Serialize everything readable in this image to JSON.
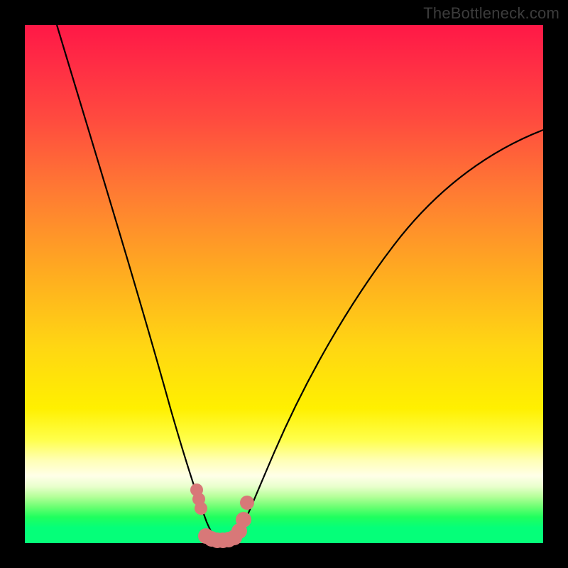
{
  "watermark_text": "TheBottleneck.com",
  "chart_data": {
    "type": "line",
    "title": "",
    "xlabel": "",
    "ylabel": "",
    "xlim": [
      0,
      100
    ],
    "ylim": [
      0,
      100
    ],
    "grid": false,
    "legend": false,
    "background_gradient": {
      "direction": "vertical",
      "stops": [
        {
          "pos": 0,
          "color": "#ff1846"
        },
        {
          "pos": 48,
          "color": "#ffac20"
        },
        {
          "pos": 74,
          "color": "#fff000"
        },
        {
          "pos": 89,
          "color": "#eaffce"
        },
        {
          "pos": 100,
          "color": "#05ff79"
        }
      ]
    },
    "series": [
      {
        "name": "left-branch",
        "x": [
          6,
          10,
          14,
          18,
          22,
          26,
          29,
          31,
          33,
          34.5,
          36
        ],
        "y": [
          100,
          83,
          67,
          52,
          38,
          25,
          15,
          9,
          4,
          1.5,
          0
        ]
      },
      {
        "name": "right-branch",
        "x": [
          40,
          42,
          45,
          50,
          56,
          63,
          71,
          80,
          90,
          100
        ],
        "y": [
          0,
          4,
          12,
          26,
          40,
          52,
          62,
          70,
          76,
          80
        ]
      }
    ],
    "min_markers": {
      "comment": "salmon dot cluster marking the flat minimum region",
      "points": [
        {
          "x": 33.0,
          "y": 10.5
        },
        {
          "x": 33.5,
          "y": 8.5
        },
        {
          "x": 34.0,
          "y": 6.5
        },
        {
          "x": 35.0,
          "y": 0.8
        },
        {
          "x": 36.0,
          "y": 0.5
        },
        {
          "x": 37.0,
          "y": 0.5
        },
        {
          "x": 38.0,
          "y": 0.5
        },
        {
          "x": 39.0,
          "y": 0.5
        },
        {
          "x": 40.0,
          "y": 0.8
        },
        {
          "x": 41.0,
          "y": 2.0
        },
        {
          "x": 42.0,
          "y": 5.0
        },
        {
          "x": 42.5,
          "y": 8.0
        }
      ],
      "color": "#d87878"
    }
  }
}
